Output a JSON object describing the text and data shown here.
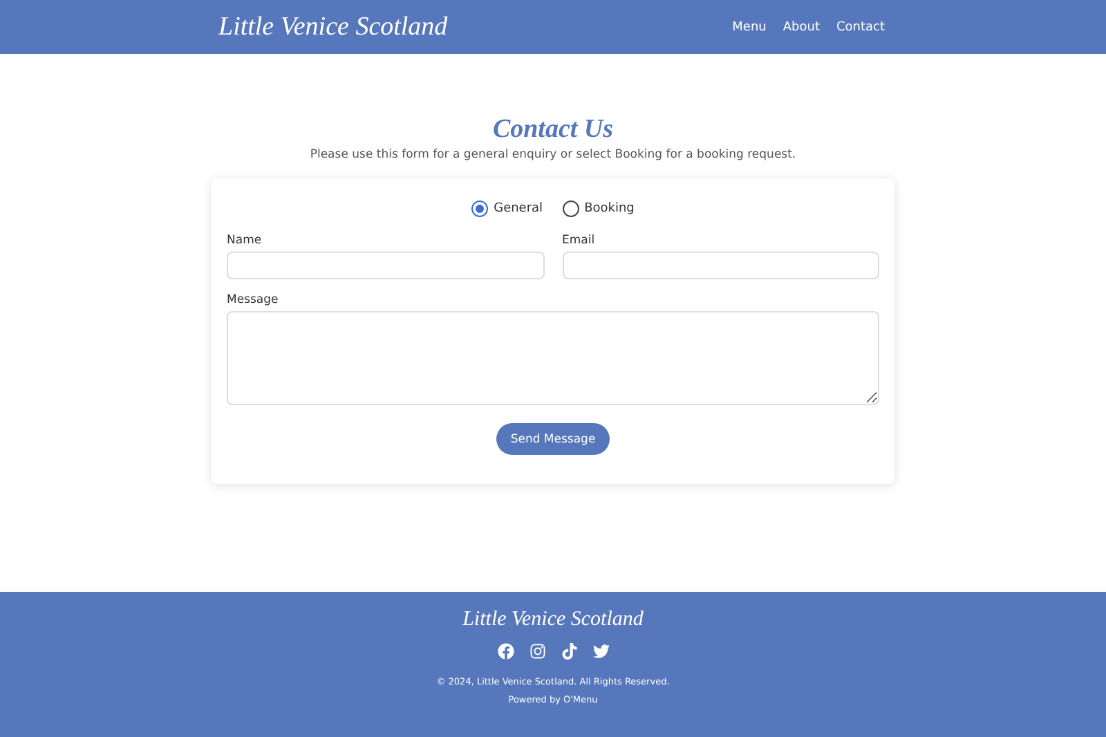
{
  "header": {
    "logo": "Little Venice Scotland",
    "nav": [
      "Menu",
      "About",
      "Contact"
    ]
  },
  "page": {
    "title": "Contact Us",
    "intro": "Please use this form for a general enquiry or select Booking for a booking request."
  },
  "form": {
    "options": [
      {
        "label": "General",
        "selected": true
      },
      {
        "label": "Booking",
        "selected": false
      }
    ],
    "fields": [
      {
        "label": "Name",
        "kind": "line"
      },
      {
        "label": "Email",
        "kind": "line"
      },
      {
        "label": "Message",
        "kind": "area"
      }
    ],
    "submit": "Send Message"
  },
  "footer": {
    "logo": "Little Venice Scotland",
    "social": [
      {
        "kind": "facebook"
      },
      {
        "kind": "instagram"
      },
      {
        "kind": "tiktok"
      },
      {
        "kind": "twitter"
      }
    ],
    "copyright": "© 2024, Little Venice Scotland. All Rights Reserved.",
    "powered": "Powered by O'Menu"
  }
}
